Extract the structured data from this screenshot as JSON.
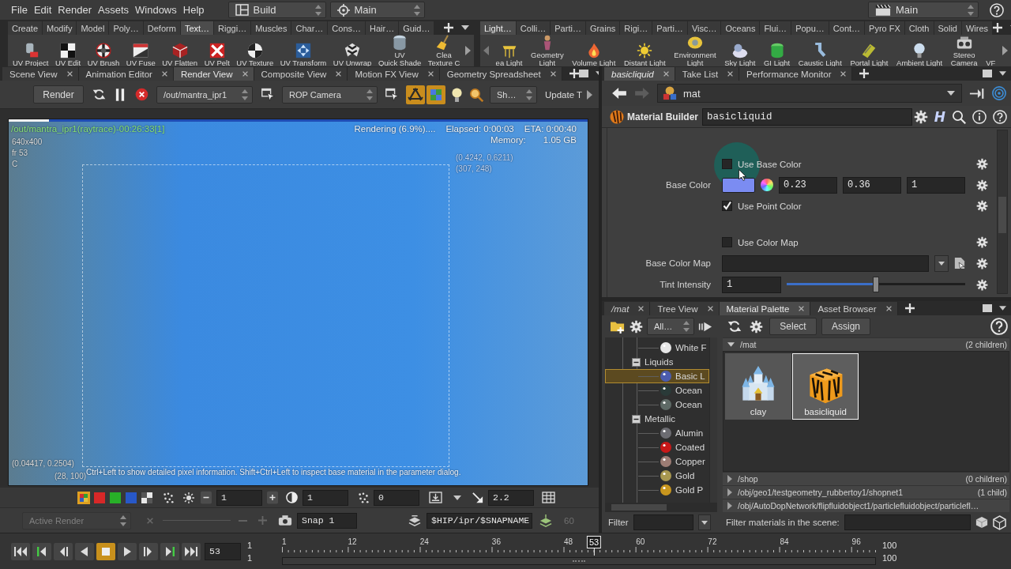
{
  "menu_bar": {
    "menus": [
      "File",
      "Edit",
      "Render",
      "Assets",
      "Windows",
      "Help"
    ],
    "desktop": "Build",
    "context": "Main",
    "run_context": "Main"
  },
  "shelves": [
    {
      "tabs": [
        {
          "label": "Create",
          "selected": false
        },
        {
          "label": "Modify",
          "selected": false
        },
        {
          "label": "Model",
          "selected": false
        },
        {
          "label": "Poly…",
          "selected": false
        },
        {
          "label": "Deform",
          "selected": false
        },
        {
          "label": "Text…",
          "selected": true
        },
        {
          "label": "Riggi…",
          "selected": false
        },
        {
          "label": "Muscles",
          "selected": false
        },
        {
          "label": "Char…",
          "selected": false
        },
        {
          "label": "Cons…",
          "selected": false
        },
        {
          "label": "Hair…",
          "selected": false
        },
        {
          "label": "Guid…",
          "selected": false
        }
      ],
      "tools": [
        "UV Project",
        "UV Edit",
        "UV Brush",
        "UV Fuse",
        "UV Flatten",
        "UV Pelt",
        "UV Texture",
        "UV Transform",
        "UV Unwrap",
        "UV\nQuick Shade",
        "Clea\nTexture C"
      ]
    },
    {
      "tabs": [
        {
          "label": "Light…",
          "selected": true
        },
        {
          "label": "Colli…",
          "selected": false
        },
        {
          "label": "Parti…",
          "selected": false
        },
        {
          "label": "Grains",
          "selected": false
        },
        {
          "label": "Rigi…",
          "selected": false
        },
        {
          "label": "Parti…",
          "selected": false
        },
        {
          "label": "Visc…",
          "selected": false
        },
        {
          "label": "Oceans",
          "selected": false
        },
        {
          "label": "Flui…",
          "selected": false
        },
        {
          "label": "Popu…",
          "selected": false
        },
        {
          "label": "Cont…",
          "selected": false
        },
        {
          "label": "Pyro FX",
          "selected": false
        },
        {
          "label": "Cloth",
          "selected": false
        },
        {
          "label": "Solid",
          "selected": false
        },
        {
          "label": "Wires",
          "selected": false
        }
      ],
      "tools": [
        "ea Light",
        "Geometry\nLight",
        "Volume Light",
        "Distant Light",
        "Environment\nLight",
        "Sky Light",
        "GI Light",
        "Caustic Light",
        "Portal Light",
        "Ambient Light",
        "Stereo\nCamera",
        "VF"
      ]
    }
  ],
  "left_pane": {
    "tabs": [
      {
        "label": "Scene View",
        "selected": false
      },
      {
        "label": "Animation Editor",
        "selected": false
      },
      {
        "label": "Render View",
        "selected": true
      },
      {
        "label": "Composite View",
        "selected": false
      },
      {
        "label": "Motion FX View",
        "selected": false
      },
      {
        "label": "Geometry Spreadsheet",
        "selected": false
      }
    ],
    "render_toolbar": {
      "render": "Render",
      "driver": "/out/mantra_ipr1",
      "camera": "ROP Camera",
      "toggles": [
        {
          "on": true
        },
        {
          "on": true
        }
      ],
      "display": "Sh…",
      "update": "Update T"
    },
    "viewport": {
      "title": "/out/mantra_ipr1(raytrace)-00:26:33[1]",
      "resolution": "640x400",
      "frame": "fr 53",
      "plane": "C",
      "progress": {
        "text": "Rendering (6.9%)....",
        "level": 0.069
      },
      "elapsed": "Elapsed: 0:00:03",
      "eta": "ETA: 0:00:40",
      "memory_label": "Memory:",
      "memory": "1.05 GB",
      "region_uv": "(0.4242, 0.6211)",
      "region_pixel": "(307, 248)",
      "cursor_uv": "(0.04417, 0.2504)",
      "cursor_pixel": "(28, 100)",
      "hint": "Ctrl+Left to show detailed pixel information. Shift+Ctrl+Left to inspect base material in the parameter dialog."
    },
    "view_toolbar": {
      "channels": [
        {
          "kind": "rgb",
          "selected": true
        },
        {
          "kind": "solid",
          "color": "#d82828",
          "selected": false
        },
        {
          "kind": "solid",
          "color": "#28b028",
          "selected": false
        },
        {
          "kind": "solid",
          "color": "#2858c8",
          "selected": false
        },
        {
          "kind": "alpha",
          "selected": false
        }
      ],
      "values": [
        "1",
        "1",
        "0",
        "2.2"
      ]
    },
    "status_bar": {
      "active_render": {
        "label": "Active Render",
        "disabled": true
      },
      "snapshot": "Snap 1",
      "snapshot_path": "$HIP/ipr/$SNAPNAME",
      "snapshot_limit": {
        "text": "60",
        "disabled": true
      }
    }
  },
  "right_pane": {
    "tabs": [
      {
        "label": "basicliquid",
        "selected": true,
        "linked": true
      },
      {
        "label": "Take List",
        "selected": false,
        "linked": false
      },
      {
        "label": "Performance Monitor",
        "selected": false,
        "linked": false
      }
    ],
    "path": "mat",
    "node": {
      "type": "Material Builder",
      "name": "basicliquid",
      "type_glyph": "H"
    },
    "params": {
      "groups": [
        [
          {
            "kind": "toggle",
            "label": "Use Base Color",
            "checked": false
          },
          {
            "kind": "color",
            "label": "Base Color",
            "color": "#7b8cf2",
            "values": [
              "0.23",
              "0.36",
              "1"
            ]
          },
          {
            "kind": "toggle",
            "label": "Use Point Color",
            "checked": true
          }
        ],
        [
          {
            "kind": "toggle",
            "label": "Use Color Map",
            "checked": false
          },
          {
            "kind": "file",
            "label": "Base Color Map"
          },
          {
            "kind": "slider",
            "label": "Tint Intensity",
            "value": "1",
            "level": 0.5
          }
        ]
      ]
    }
  },
  "palette": {
    "tabs": [
      {
        "label": "/mat",
        "selected": false,
        "linked": true
      },
      {
        "label": "Tree View",
        "selected": false,
        "linked": false
      },
      {
        "label": "Material Palette",
        "selected": true,
        "linked": false
      },
      {
        "label": "Asset Browser",
        "selected": false,
        "linked": false
      }
    ],
    "library_menu": "All…",
    "tree": [
      {
        "kind": "material",
        "label": "White F",
        "color": "#e6e6e6",
        "selected": false
      },
      {
        "kind": "folder",
        "label": "Liquids",
        "expanded": true,
        "selected": false,
        "children": [
          {
            "kind": "material",
            "label": "Basic L",
            "color": "#4b5cae",
            "selected": true
          },
          {
            "kind": "material",
            "label": "Ocean",
            "color": "#2a3a38",
            "selected": false
          },
          {
            "kind": "material",
            "label": "Ocean",
            "color": "#5e6a66",
            "selected": false
          }
        ]
      },
      {
        "kind": "folder",
        "label": "Metallic",
        "expanded": true,
        "selected": false,
        "children": [
          {
            "kind": "material",
            "label": "Alumin",
            "color": "#6c6c72",
            "selected": false
          },
          {
            "kind": "material",
            "label": "Coated",
            "color": "#c81818",
            "selected": false
          },
          {
            "kind": "material",
            "label": "Copper",
            "color": "#9c7c74",
            "selected": false
          },
          {
            "kind": "material",
            "label": "Gold",
            "color": "#a89850",
            "selected": false
          },
          {
            "kind": "material",
            "label": "Gold P",
            "color": "#c8961e",
            "selected": false
          }
        ]
      }
    ],
    "filter_label": "Filter",
    "select": "Select",
    "assign": "Assign",
    "sections": [
      {
        "path": "/mat",
        "count": "(2 children)",
        "expanded": true,
        "materials": [
          {
            "label": "clay",
            "selected": false
          },
          {
            "label": "basicliquid",
            "selected": true
          }
        ]
      },
      {
        "path": "/shop",
        "count": "(0 children)",
        "expanded": false
      },
      {
        "path": "/obj/geo1/testgeometry_rubbertoy1/shopnet1",
        "count": "(1 child)",
        "expanded": false
      },
      {
        "path": "/obj/AutoDopNetwork/flipfluidobject1/particlefluidobject/particlefl…",
        "expanded": false
      }
    ],
    "scene_filter_label": "Filter materials in the scene:"
  },
  "timeline": {
    "controls": [
      {
        "selected": false
      },
      {
        "selected": false
      },
      {
        "selected": false
      },
      {
        "selected": false
      },
      {
        "selected": true
      },
      {
        "selected": false
      },
      {
        "selected": false
      },
      {
        "selected": false
      },
      {
        "selected": false
      }
    ],
    "frame": "53",
    "start": [
      "1",
      "1"
    ],
    "ticks": [
      "1",
      "12",
      "24",
      "36",
      "48",
      "60",
      "72",
      "84",
      "96"
    ],
    "playhead": {
      "label": "53",
      "level": 0.5253
    },
    "end": [
      "100",
      "100"
    ]
  }
}
